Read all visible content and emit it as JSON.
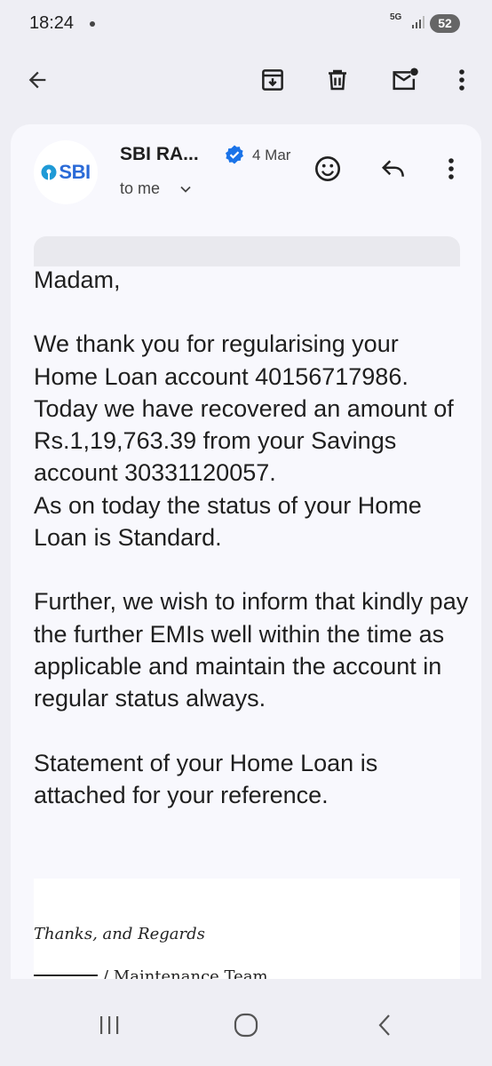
{
  "status_bar": {
    "time": "18:24",
    "network": "5G",
    "battery": "52"
  },
  "toolbar": {
    "back_icon": "arrow-left-icon",
    "archive_icon": "archive-icon",
    "delete_icon": "trash-icon",
    "mark_unread_icon": "mail-unread-icon",
    "more_icon": "more-vert-icon"
  },
  "email": {
    "sender_logo": "SBI",
    "sender": "SBI RA...",
    "date": "4 Mar",
    "recipient": "to me",
    "body": {
      "greeting": "Madam,",
      "para1": "We thank you for regularising your Home Loan account 40156717986.  Today  we have recovered an amount of Rs.1,19,763.39 from your Savings account 30331120057.",
      "para2": "As on today the status of your Home Loan is Standard.",
      "para3": "Further, we wish to inform that kindly pay the further EMIs well within the time as applicable and maintain the account in regular status always.",
      "para4": "Statement of your Home Loan is attached for your reference."
    },
    "signature": {
      "text": "Thanks, and Regards",
      "cut_line": "/ Maintenance Team"
    }
  },
  "colors": {
    "background": "#eeeef4",
    "card": "#f8f8fd",
    "verified_blue": "#1a73e8",
    "sbi_blue": "#2a6ad7"
  }
}
